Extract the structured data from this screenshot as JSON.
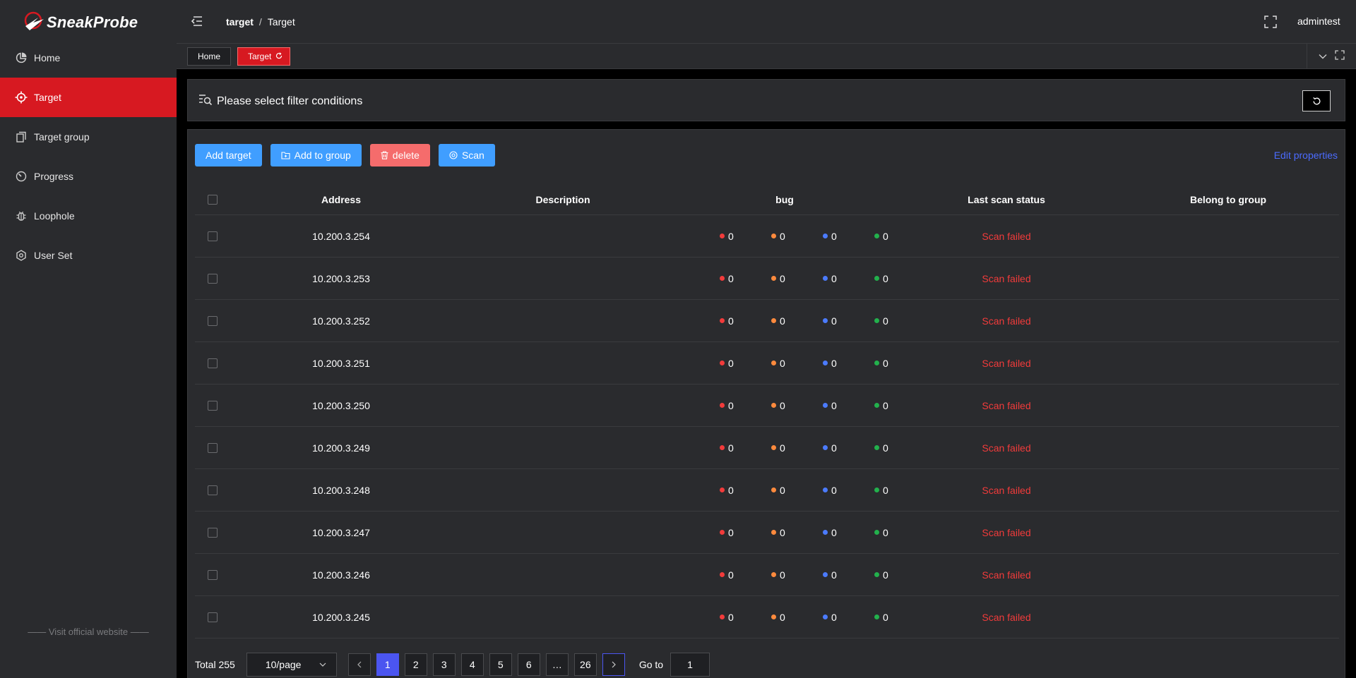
{
  "app": {
    "logo_text": "SneakProbe"
  },
  "sidebar": {
    "items": [
      {
        "label": "Home",
        "icon": "pie-chart-icon",
        "active": false
      },
      {
        "label": "Target",
        "icon": "crosshair-icon",
        "active": true
      },
      {
        "label": "Target group",
        "icon": "copy-icon",
        "active": false
      },
      {
        "label": "Progress",
        "icon": "gauge-icon",
        "active": false
      },
      {
        "label": "Loophole",
        "icon": "bug-icon",
        "active": false
      },
      {
        "label": "User Set",
        "icon": "hexagon-gear-icon",
        "active": false
      }
    ],
    "footer_link": "Visit official website"
  },
  "header": {
    "breadcrumb": [
      "target",
      "Target"
    ],
    "username": "admintest"
  },
  "tags": {
    "home": "Home",
    "target": "Target"
  },
  "filter": {
    "title": "Please select filter conditions"
  },
  "toolbar": {
    "add_target": "Add target",
    "add_to_group": "Add to group",
    "delete": "delete",
    "scan": "Scan",
    "edit_properties": "Edit properties"
  },
  "table": {
    "columns": [
      "Address",
      "Description",
      "bug",
      "Last scan status",
      "Belong to group"
    ],
    "bug_colors": [
      "#f23b3b",
      "#ff8a3d",
      "#4b7bff",
      "#22b14c"
    ],
    "rows": [
      {
        "address": "10.200.3.254",
        "description": "",
        "bugs": [
          "0",
          "0",
          "0",
          "0"
        ],
        "status": "Scan failed",
        "group": ""
      },
      {
        "address": "10.200.3.253",
        "description": "",
        "bugs": [
          "0",
          "0",
          "0",
          "0"
        ],
        "status": "Scan failed",
        "group": ""
      },
      {
        "address": "10.200.3.252",
        "description": "",
        "bugs": [
          "0",
          "0",
          "0",
          "0"
        ],
        "status": "Scan failed",
        "group": ""
      },
      {
        "address": "10.200.3.251",
        "description": "",
        "bugs": [
          "0",
          "0",
          "0",
          "0"
        ],
        "status": "Scan failed",
        "group": ""
      },
      {
        "address": "10.200.3.250",
        "description": "",
        "bugs": [
          "0",
          "0",
          "0",
          "0"
        ],
        "status": "Scan failed",
        "group": ""
      },
      {
        "address": "10.200.3.249",
        "description": "",
        "bugs": [
          "0",
          "0",
          "0",
          "0"
        ],
        "status": "Scan failed",
        "group": ""
      },
      {
        "address": "10.200.3.248",
        "description": "",
        "bugs": [
          "0",
          "0",
          "0",
          "0"
        ],
        "status": "Scan failed",
        "group": ""
      },
      {
        "address": "10.200.3.247",
        "description": "",
        "bugs": [
          "0",
          "0",
          "0",
          "0"
        ],
        "status": "Scan failed",
        "group": ""
      },
      {
        "address": "10.200.3.246",
        "description": "",
        "bugs": [
          "0",
          "0",
          "0",
          "0"
        ],
        "status": "Scan failed",
        "group": ""
      },
      {
        "address": "10.200.3.245",
        "description": "",
        "bugs": [
          "0",
          "0",
          "0",
          "0"
        ],
        "status": "Scan failed",
        "group": ""
      }
    ]
  },
  "pagination": {
    "total": "Total 255",
    "page_size": "10/page",
    "pages": [
      "1",
      "2",
      "3",
      "4",
      "5",
      "6",
      "…",
      "26"
    ],
    "current": "1",
    "goto_label": "Go to",
    "goto_value": "1"
  },
  "colors": {
    "accent_red": "#d71921",
    "primary_blue": "#409eff",
    "danger": "#f56c6c",
    "link": "#4b6bff"
  }
}
